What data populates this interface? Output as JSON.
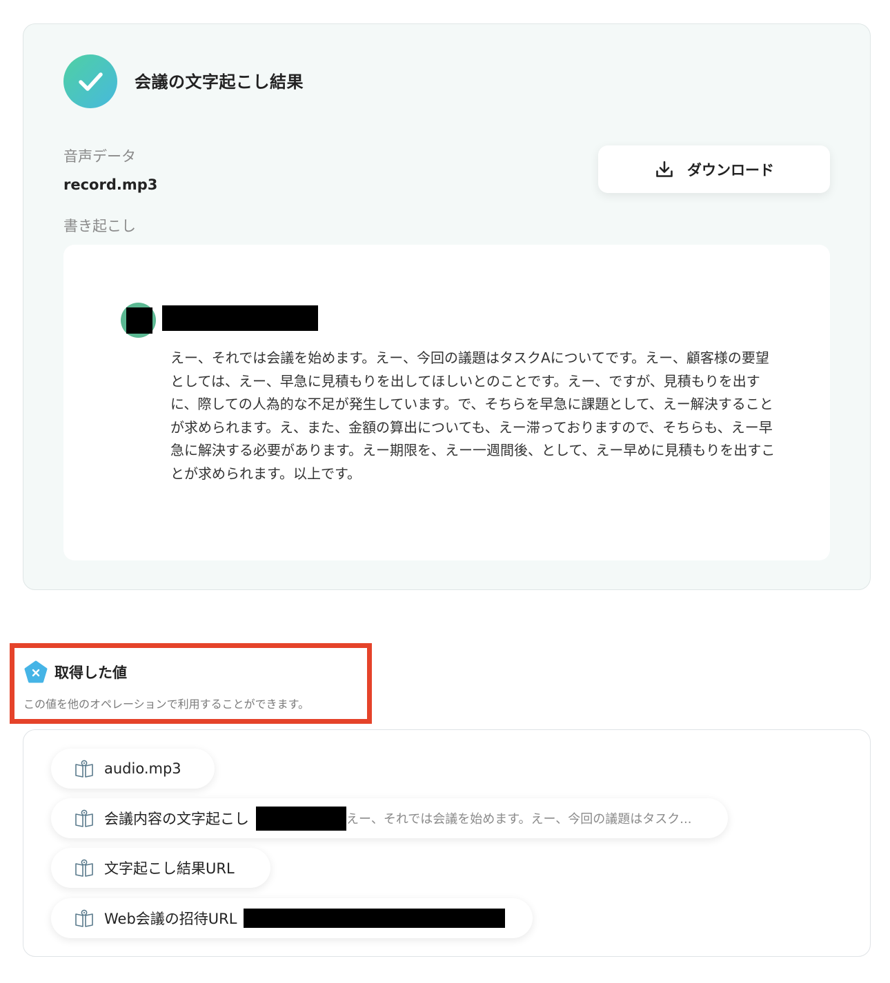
{
  "result": {
    "title": "会議の文字起こし結果",
    "audio_label": "音声データ",
    "audio_file": "record.mp3",
    "download_label": "ダウンロード",
    "transcript_label": "書き起こし",
    "transcript_text": "えー、それでは会議を始めます。えー、今回の議題はタスクAについてです。えー、顧客様の要望としては、えー、早急に見積もりを出してほしいとのことです。えー、ですが、見積もりを出すに、際しての人為的な不足が発生しています。で、そちらを早急に課題として、えー解決することが求められます。え、また、金額の算出についても、えー滞っておりますので、そちらも、えー早急に解決する必要があります。えー期限を、えー一週間後、として、えー早めに見積もりを出すことが求められます。以上です。"
  },
  "acquired": {
    "title": "取得した値",
    "description": "この値を他のオペレーションで利用することができます。",
    "items": [
      {
        "label": "audio.mp3"
      },
      {
        "label": "会議内容の文字起こし",
        "preview": "えー、それでは会議を始めます。えー、今回の議題はタスク..."
      },
      {
        "label": "文字起こし結果URL"
      },
      {
        "label": "Web会議の招待URL"
      }
    ]
  },
  "icons": {
    "status": "check-icon",
    "download": "download-icon",
    "acquired": "variable-pentagon-icon",
    "value": "value-book-icon"
  },
  "colors": {
    "accent_start": "#4fd0a3",
    "accent_end": "#47b9dd",
    "highlight_border": "#e5432a",
    "card_bg": "#f4f9f8"
  }
}
